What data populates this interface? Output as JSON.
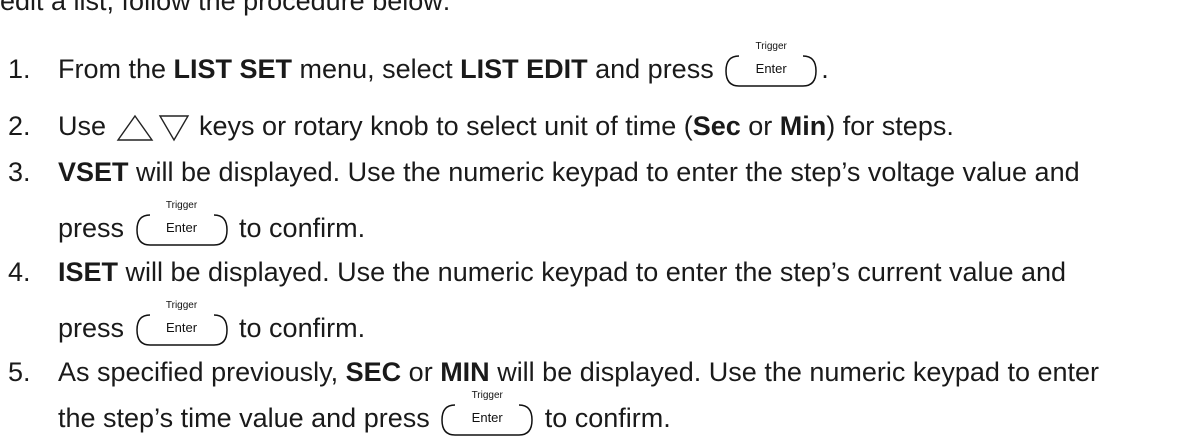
{
  "intro": "edit a list, follow the procedure below:",
  "key": {
    "top_label": "Trigger",
    "label": "Enter"
  },
  "icons": {
    "up": "triangle-up-icon",
    "down": "triangle-down-icon"
  },
  "steps": [
    {
      "num": "1.",
      "a": "From the ",
      "b1": "LIST SET",
      "c": " menu, select ",
      "b2": "LIST EDIT",
      "d": " and press ",
      "e": "."
    },
    {
      "num": "2.",
      "a": "Use",
      "c": " keys or rotary knob to select unit of time (",
      "b1": "Sec",
      "d": " or ",
      "b2": "Min",
      "e": ") for steps."
    },
    {
      "num": "3.",
      "b1": "VSET",
      "a": " will be displayed. Use the numeric keypad to enter the step’s voltage value and",
      "l2a": "press ",
      "l2b": " to confirm."
    },
    {
      "num": "4.",
      "b1": "ISET",
      "a": " will be displayed. Use the numeric keypad to enter the step’s current value and",
      "l2a": "press ",
      "l2b": " to confirm."
    },
    {
      "num": "5.",
      "a": "As specified previously, ",
      "b1": "SEC",
      "c": " or ",
      "b2": "MIN",
      "d": " will be displayed. Use the numeric keypad to enter",
      "l2a": "the step’s time value and press ",
      "l2b": " to confirm."
    }
  ]
}
